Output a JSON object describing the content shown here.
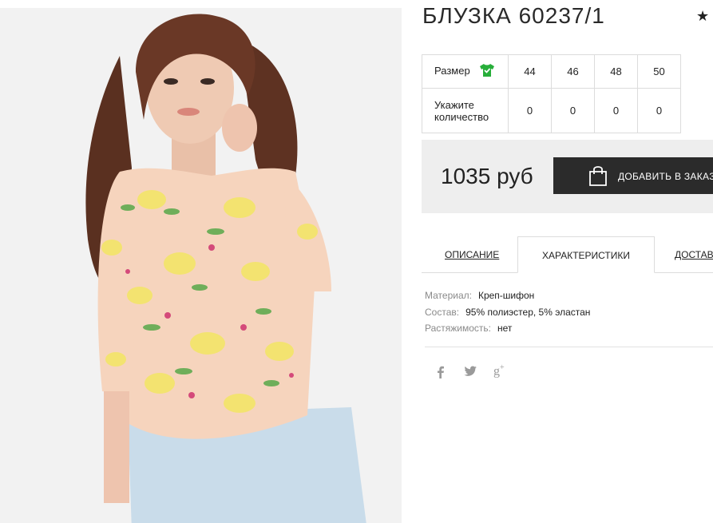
{
  "product": {
    "title": "БЛУЗКА 60237/1",
    "rating_icon": "star-icon"
  },
  "sizes": {
    "size_label": "Размер",
    "qty_label_1": "Укажите",
    "qty_label_2": "количество",
    "items": [
      {
        "size": "44",
        "qty": "0"
      },
      {
        "size": "46",
        "qty": "0"
      },
      {
        "size": "48",
        "qty": "0"
      },
      {
        "size": "50",
        "qty": "0"
      }
    ]
  },
  "price": {
    "value": "1035 руб",
    "button_label": "ДОБАВИТЬ В ЗАКАЗ"
  },
  "tabs": [
    "ОПИСАНИЕ",
    "ХАРАКТЕРИСТИКИ",
    "ДОСТАВКА"
  ],
  "specs": [
    {
      "key": "Материал:",
      "value": "Креп-шифон"
    },
    {
      "key": "Состав:",
      "value": "95% полиэстер, 5% эластан"
    },
    {
      "key": "Растяжимость:",
      "value": "нет"
    }
  ],
  "social": {
    "icons": [
      "facebook-icon",
      "twitter-icon",
      "google-plus-icon"
    ]
  },
  "colors": {
    "accent_green": "#27ae3a",
    "button_dark": "#2b2b2b",
    "price_bg": "#eeeeee"
  }
}
